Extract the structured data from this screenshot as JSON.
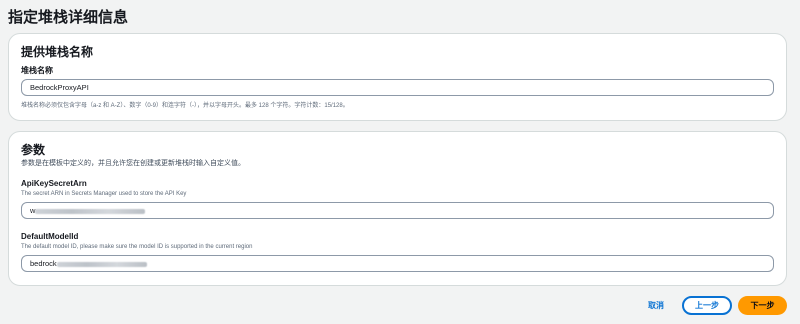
{
  "page": {
    "title": "指定堆栈详细信息"
  },
  "stack_name_section": {
    "title": "提供堆栈名称",
    "field_label": "堆栈名称",
    "value": "BedrockProxyAPI",
    "hint": "堆栈名称必须仅包含字母（a-z 和 A-Z）、数字（0-9）和连字符（-），并以字母开头。最多 128 个字符。字符计数：15/128。"
  },
  "params_section": {
    "title": "参数",
    "description": "参数是在模板中定义的，并且允许您在创建或更新堆栈时输入自定义值。",
    "api_key": {
      "label": "ApiKeySecretArn",
      "description": "The secret ARN in Secrets Manager used to store the API Key",
      "value_prefix": "w"
    },
    "default_model": {
      "label": "DefaultModelId",
      "description": "The default model ID, please make sure the model ID is supported in the current region",
      "value_prefix": "bedrock"
    }
  },
  "footer": {
    "cancel": "取消",
    "previous": "上一步",
    "next": "下一步"
  },
  "colors": {
    "background": "#f2f3f3",
    "link_blue": "#0972d3",
    "primary_orange": "#ff9900"
  }
}
